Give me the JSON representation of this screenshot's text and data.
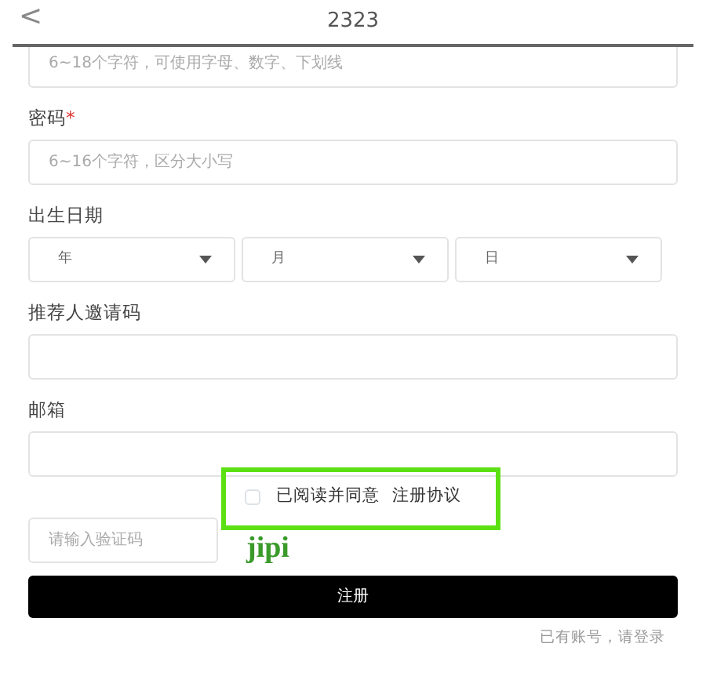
{
  "header": {
    "back": "<",
    "title": "2323"
  },
  "fields": [
    {
      "kind": "input",
      "placeholder": "6~18个字符，可使用字母、数字、下划线"
    },
    {
      "kind": "input",
      "label": "密码",
      "required_mark": "*",
      "placeholder": "6~16个字符，区分大小写"
    },
    {
      "kind": "date",
      "label": "出生日期",
      "selects": [
        "年",
        "月",
        "日"
      ]
    },
    {
      "kind": "input",
      "label": "推荐人邀请码"
    },
    {
      "kind": "input",
      "label": "邮箱"
    }
  ],
  "agreement": {
    "checked": false,
    "text": "已阅读并同意",
    "link": "注册协议",
    "highlighted": true
  },
  "captcha": {
    "placeholder": "请输入验证码",
    "code": "jipi"
  },
  "submit": "注册",
  "login_link": "已有账号，请登录"
}
